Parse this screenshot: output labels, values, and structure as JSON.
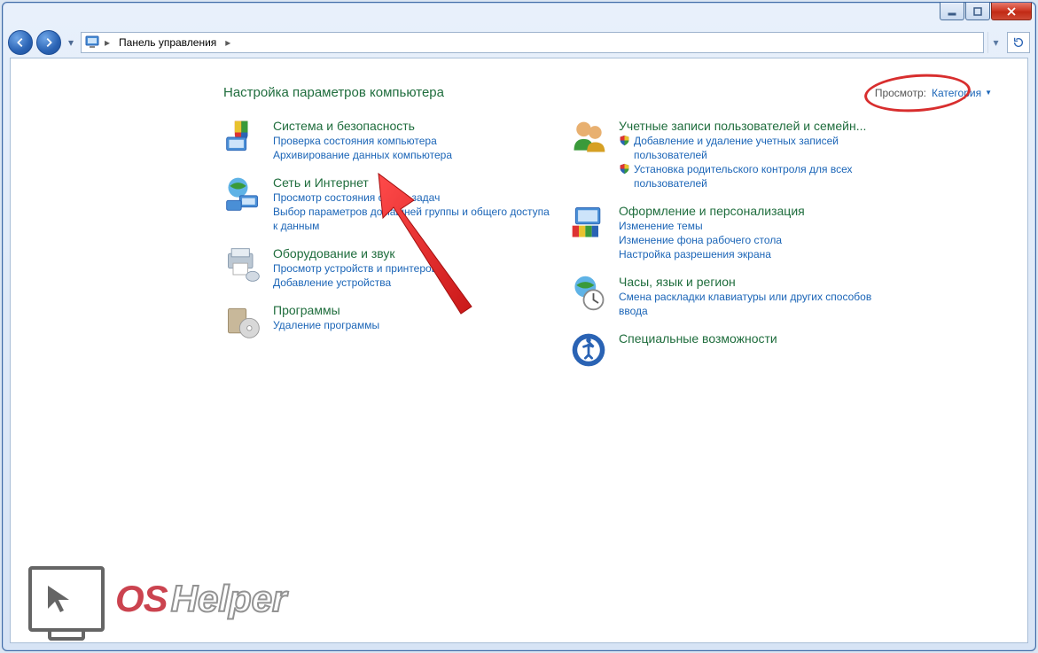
{
  "window": {
    "breadcrumb_root": "Панель управления"
  },
  "heading": {
    "title": "Настройка параметров компьютера",
    "view_label": "Просмотр:",
    "view_value": "Категория"
  },
  "left_categories": [
    {
      "id": "system-security",
      "title": "Система и безопасность",
      "links": [
        "Проверка состояния компьютера",
        "Архивирование данных компьютера"
      ]
    },
    {
      "id": "network-internet",
      "title": "Сеть и Интернет",
      "links": [
        "Просмотр состояния сети и задач",
        "Выбор параметров домашней группы и общего доступа к данным"
      ]
    },
    {
      "id": "hardware-sound",
      "title": "Оборудование и звук",
      "links": [
        "Просмотр устройств и принтеров",
        "Добавление устройства"
      ]
    },
    {
      "id": "programs",
      "title": "Программы",
      "links": [
        "Удаление программы"
      ]
    }
  ],
  "right_categories": [
    {
      "id": "user-accounts",
      "title": "Учетные записи пользователей и семейн...",
      "links_shield": [
        "Добавление и удаление учетных записей пользователей",
        "Установка родительского контроля для всех пользователей"
      ]
    },
    {
      "id": "appearance",
      "title": "Оформление и персонализация",
      "links": [
        "Изменение темы",
        "Изменение фона рабочего стола",
        "Настройка разрешения экрана"
      ]
    },
    {
      "id": "clock-region",
      "title": "Часы, язык и регион",
      "links": [
        "Смена раскладки клавиатуры или других способов ввода"
      ]
    },
    {
      "id": "ease-of-access",
      "title": "Специальные возможности",
      "links": []
    }
  ],
  "watermark": {
    "os": "OS",
    "helper": "Helper"
  }
}
